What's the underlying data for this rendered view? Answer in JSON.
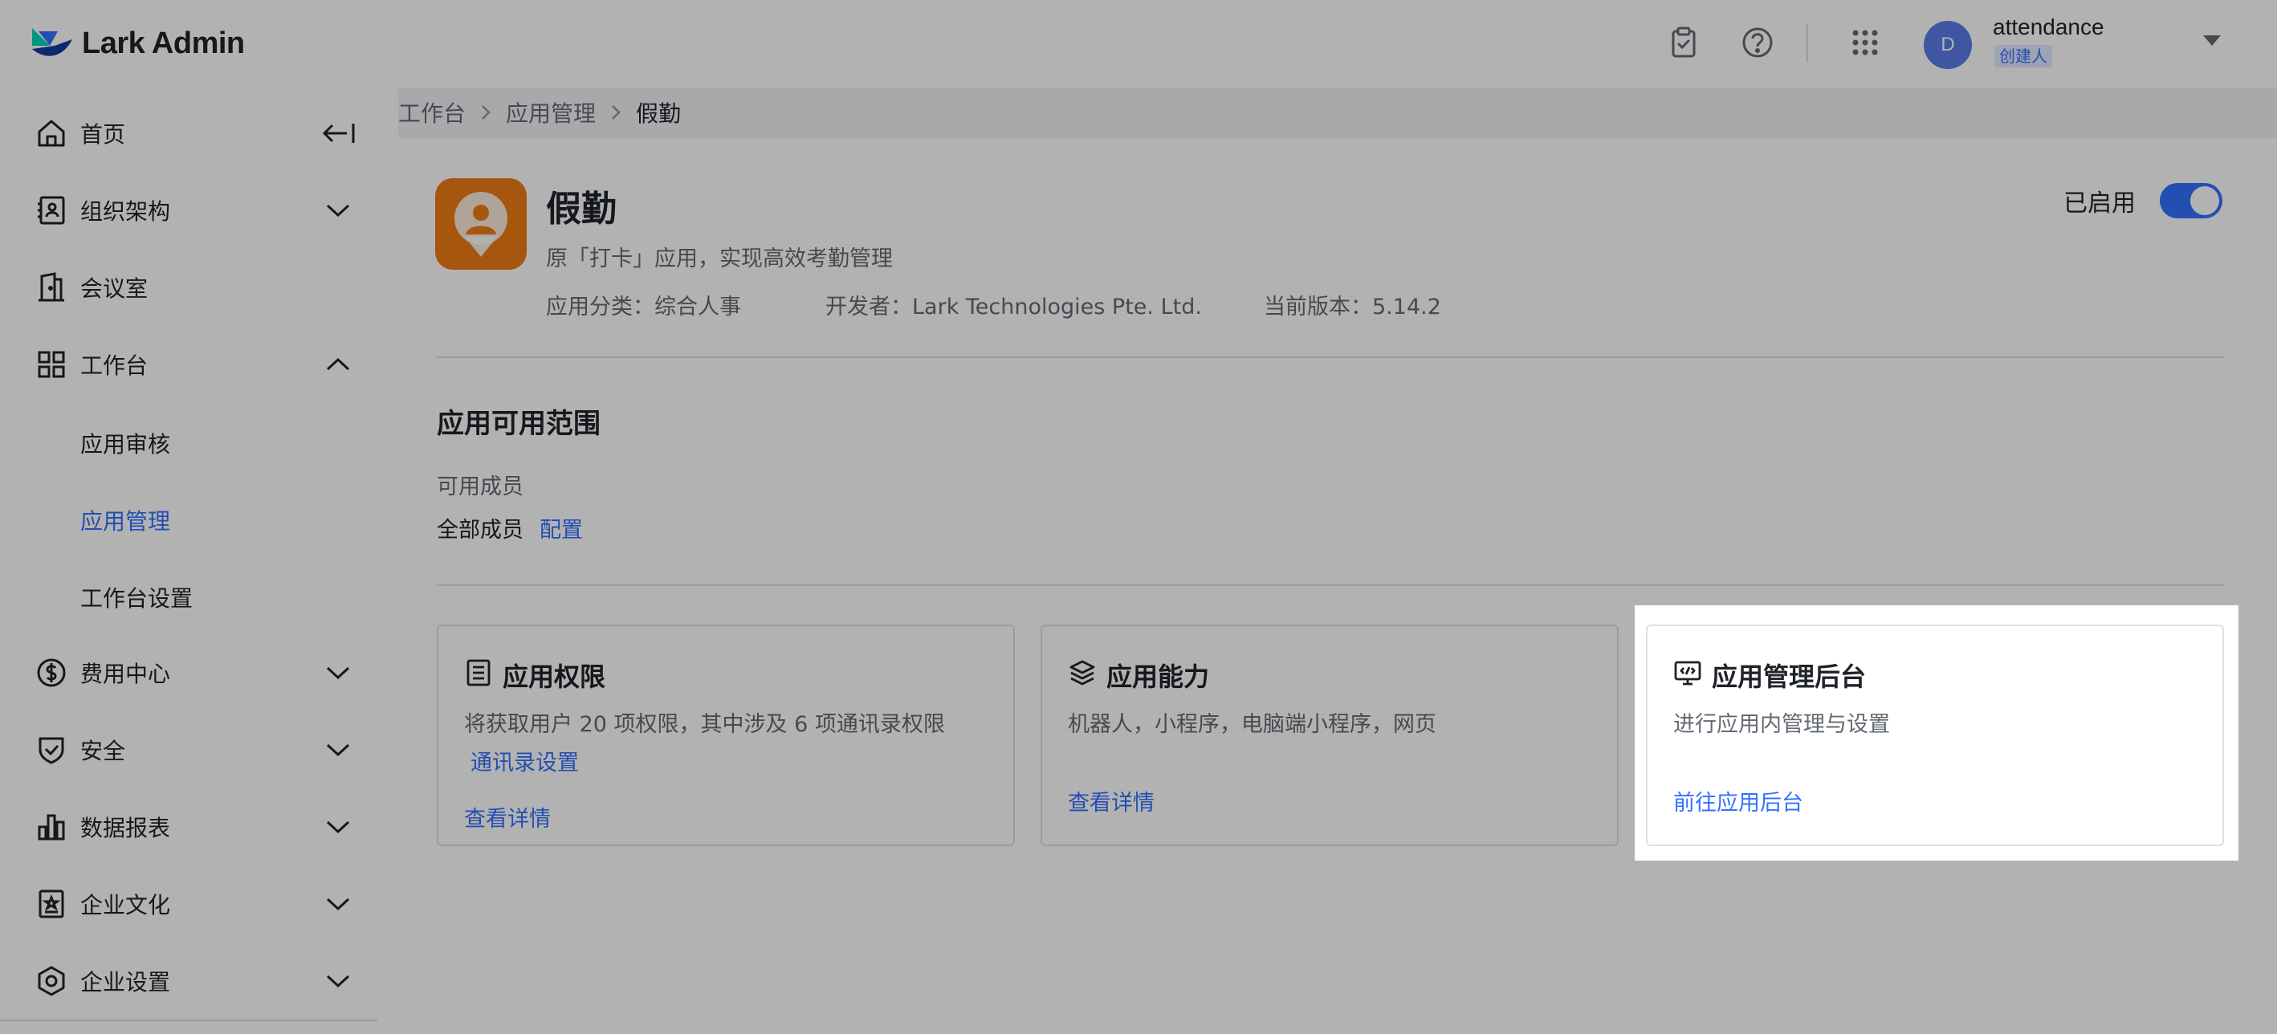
{
  "brand": {
    "logo_text": "Lark Admin"
  },
  "header": {
    "avatar_letter": "D",
    "user_name": "attendance",
    "user_role": "创建人",
    "icons": [
      "clipboard-check-icon",
      "help-icon",
      "app-grid-icon",
      "caret-down-icon"
    ]
  },
  "sidebar": {
    "items": [
      {
        "label": "首页",
        "icon": "home-icon"
      },
      {
        "label": "组织架构",
        "icon": "org-icon"
      },
      {
        "label": "会议室",
        "icon": "meeting-room-icon"
      },
      {
        "label": "工作台",
        "icon": "workplace-icon"
      },
      {
        "label": "费用中心",
        "icon": "billing-icon"
      },
      {
        "label": "安全",
        "icon": "shield-icon"
      },
      {
        "label": "数据报表",
        "icon": "bar-chart-icon"
      },
      {
        "label": "企业文化",
        "icon": "culture-icon"
      },
      {
        "label": "企业设置",
        "icon": "settings-icon"
      }
    ],
    "sub_items": [
      {
        "label": "应用审核"
      },
      {
        "label": "应用管理"
      },
      {
        "label": "工作台设置"
      }
    ]
  },
  "breadcrumb": [
    "工作台",
    "应用管理",
    "假勤"
  ],
  "app": {
    "name": "假勤",
    "description": "原「打卡」应用，实现高效考勤管理",
    "category": "应用分类：综合人事",
    "developer": "开发者：Lark Technologies Pte. Ltd.",
    "version": "当前版本：5.14.2",
    "status_label": "已启用",
    "enabled": true,
    "icon_color": "#f07b14"
  },
  "scope": {
    "title": "应用可用范围",
    "members_label": "可用成员",
    "members_value": "全部成员",
    "configure_link": "配置"
  },
  "cards": [
    {
      "title": "应用权限",
      "icon": "document-list-icon",
      "desc": "将获取用户 20 项权限，其中涉及 6 项通讯录权限",
      "sub_link": "通讯录设置",
      "link": "查看详情"
    },
    {
      "title": "应用能力",
      "icon": "layers-icon",
      "desc": "机器人，小程序，电脑端小程序，网页",
      "link": "查看详情"
    },
    {
      "title": "应用管理后台",
      "icon": "code-monitor-icon",
      "desc": "进行应用内管理与设置",
      "link": "前往应用后台"
    }
  ],
  "colors": {
    "accent": "#3370ff",
    "overlay": "rgba(0,0,0,0.30)"
  }
}
